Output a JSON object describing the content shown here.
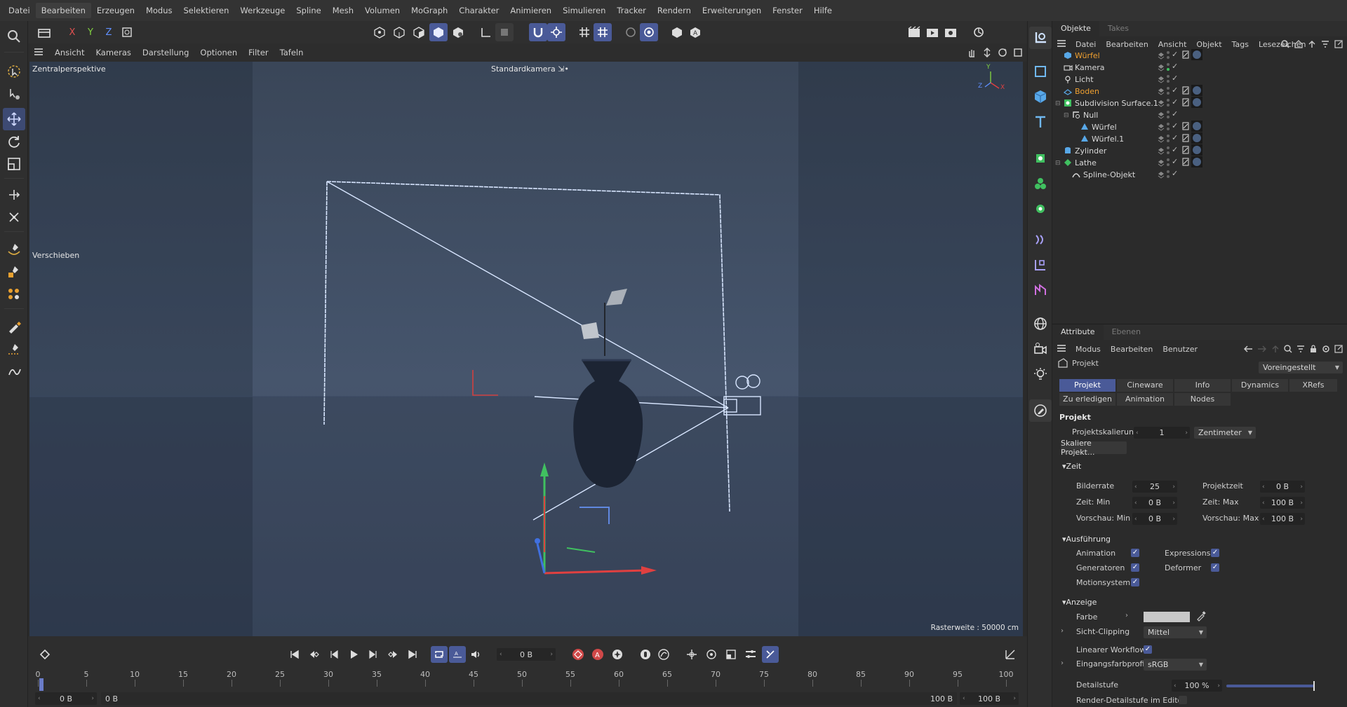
{
  "menubar": {
    "items": [
      "Datei",
      "Bearbeiten",
      "Erzeugen",
      "Modus",
      "Selektieren",
      "Werkzeuge",
      "Spline",
      "Mesh",
      "Volumen",
      "MoGraph",
      "Charakter",
      "Animieren",
      "Simulieren",
      "Tracker",
      "Rendern",
      "Erweiterungen",
      "Fenster",
      "Hilfe"
    ],
    "active": "Bearbeiten"
  },
  "toolbar": {
    "axis_x": "X",
    "axis_y": "Y",
    "axis_z": "Z"
  },
  "viewport_menu": {
    "items": [
      "Ansicht",
      "Kameras",
      "Darstellung",
      "Optionen",
      "Filter",
      "Tafeln"
    ]
  },
  "viewport": {
    "projection": "Zentralperspektive",
    "camera": "Standardkamera",
    "camera_suffix": "⇲•",
    "tool_hint": "Verschieben",
    "grid_info": "Rasterweite : 50000 cm",
    "axis_labels": {
      "y": "Y",
      "z": "Z",
      "x": "X"
    }
  },
  "timeline": {
    "current_frame": "0 B",
    "start_field": "0 B",
    "start_field2": "0 B",
    "end_field": "100 B",
    "end_field2": "100 B",
    "ticks": [
      "0",
      "5",
      "10",
      "15",
      "20",
      "25",
      "30",
      "35",
      "40",
      "45",
      "50",
      "55",
      "60",
      "65",
      "70",
      "75",
      "80",
      "85",
      "90",
      "95",
      "100"
    ]
  },
  "objects_panel": {
    "tabs": [
      "Objekte",
      "Takes"
    ],
    "active_tab": "Objekte",
    "menu": [
      "Datei",
      "Bearbeiten",
      "Ansicht",
      "Objekt",
      "Tags",
      "Lesezeichen"
    ],
    "rows": [
      {
        "name": "Würfel",
        "highlight": true,
        "indent": 0,
        "icon": "cube-icon"
      },
      {
        "name": "Kamera",
        "highlight": false,
        "indent": 0,
        "icon": "camera-icon"
      },
      {
        "name": "Licht",
        "highlight": false,
        "indent": 0,
        "icon": "light-icon"
      },
      {
        "name": "Boden",
        "highlight": true,
        "indent": 0,
        "icon": "floor-icon"
      },
      {
        "name": "Subdivision Surface.1",
        "highlight": false,
        "indent": 0,
        "icon": "subdivision-icon"
      },
      {
        "name": "Null",
        "highlight": false,
        "indent": 1,
        "icon": "null-icon"
      },
      {
        "name": "Würfel",
        "highlight": false,
        "indent": 2,
        "icon": "polygon-icon"
      },
      {
        "name": "Würfel.1",
        "highlight": false,
        "indent": 2,
        "icon": "polygon-icon"
      },
      {
        "name": "Zylinder",
        "highlight": false,
        "indent": 0,
        "icon": "cylinder-icon"
      },
      {
        "name": "Lathe",
        "highlight": false,
        "indent": 0,
        "icon": "lathe-icon"
      },
      {
        "name": "Spline-Objekt",
        "highlight": false,
        "indent": 1,
        "icon": "spline-icon"
      }
    ]
  },
  "attributes_panel": {
    "tabs": [
      "Attribute",
      "Ebenen"
    ],
    "active_tab": "Attribute",
    "menu": [
      "Modus",
      "Bearbeiten",
      "Benutzer"
    ],
    "object_label": "Projekt",
    "preset": "Voreingestellt",
    "tabs_row1": [
      "Projekt",
      "Cineware",
      "Info",
      "Dynamics",
      "XRefs"
    ],
    "tabs_row2": [
      "Zu erledigen",
      "Animation",
      "Nodes"
    ],
    "section_title": "Projekt",
    "projektskalierung_label": "Projektskalierung",
    "projektskalierung_value": "1",
    "projektskalierung_unit": "Zentimeter",
    "skaliere_button": "Skaliere Projekt...",
    "zeit": {
      "title": "Zeit",
      "bildrate_label": "Bilderrate",
      "bildrate_value": "25",
      "projektzeit_label": "Projektzeit",
      "projektzeit_value": "0 B",
      "zeitmin_label": "Zeit: Min",
      "zeitmin_value": "0 B",
      "zeitmax_label": "Zeit: Max",
      "zeitmax_value": "100 B",
      "vorschaumin_label": "Vorschau: Min",
      "vorschaumin_value": "0 B",
      "vorschaumax_label": "Vorschau: Max",
      "vorschaumax_value": "100 B"
    },
    "ausfuehrung": {
      "title": "Ausführung",
      "animation": "Animation",
      "expressions": "Expressions",
      "generatoren": "Generatoren",
      "deformer": "Deformer",
      "motionsystem": "Motionsystem"
    },
    "anzeige": {
      "title": "Anzeige",
      "farbe_label": "Farbe",
      "farbe_color": "#c8c8c8",
      "sichtclipping_label": "Sicht-Clipping",
      "sichtclipping_value": "Mittel",
      "linear_label": "Linearer Workflow",
      "eingangs_label": "Eingangsfarbprofil",
      "eingangs_value": "sRGB",
      "detailstufe_label": "Detailstufe",
      "detailstufe_value": "100 %",
      "render_detail_label": "Render-Detailstufe im Editor"
    }
  },
  "colors": {
    "accent": "#4a5a98",
    "highlight_text": "#f0a030",
    "viewport_bg": "#435269"
  }
}
